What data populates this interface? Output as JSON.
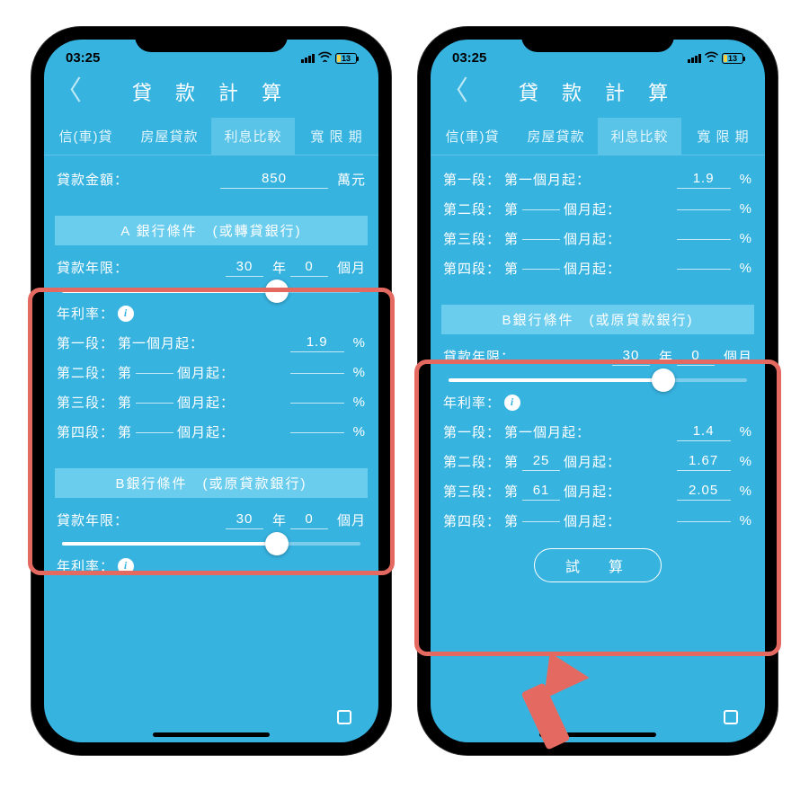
{
  "status": {
    "time": "03:25",
    "battery": "13"
  },
  "nav": {
    "title": "貸 款 計 算"
  },
  "tabs": {
    "t1": "信(車)貸",
    "t2": "房屋貸款",
    "t3": "利息比較",
    "t4": "寬 限 期"
  },
  "labels": {
    "loan_amount": "貸款金額：",
    "wan_yuan": "萬元",
    "loan_years": "貸款年限：",
    "year": "年",
    "month": "個月",
    "rate": "年利率：",
    "seg1": "第一段：",
    "seg2": "第二段：",
    "seg3": "第三段：",
    "seg4": "第四段：",
    "first_month": "第一個月起：",
    "from_month_prefix": "第",
    "from_month_suffix": "個月起：",
    "percent": "%",
    "calc": "試　算"
  },
  "bankA": {
    "header": "A 銀行條件　(或轉貸銀行)",
    "years": "30",
    "months": "0",
    "slider_pct": 72,
    "seg1_rate": "1.9",
    "seg2_m": "",
    "seg2_rate": "",
    "seg3_m": "",
    "seg3_rate": "",
    "seg4_m": "",
    "seg4_rate": ""
  },
  "bankB_left": {
    "header": "B銀行條件　(或原貸款銀行)",
    "years": "30",
    "months": "0",
    "slider_pct": 72
  },
  "left": {
    "loan_amount": "850"
  },
  "right": {
    "seg1_rate_top": "1.9",
    "seg2_m_top": "",
    "seg2_rate_top": "",
    "seg3_m_top": "",
    "seg3_rate_top": "",
    "seg4_m_top": "",
    "seg4_rate_top": ""
  },
  "bankB_right": {
    "header": "B銀行條件　(或原貸款銀行)",
    "years": "30",
    "months": "0",
    "slider_pct": 72,
    "seg1_rate": "1.4",
    "seg2_m": "25",
    "seg2_rate": "1.67",
    "seg3_m": "61",
    "seg3_rate": "2.05",
    "seg4_m": "",
    "seg4_rate": ""
  }
}
